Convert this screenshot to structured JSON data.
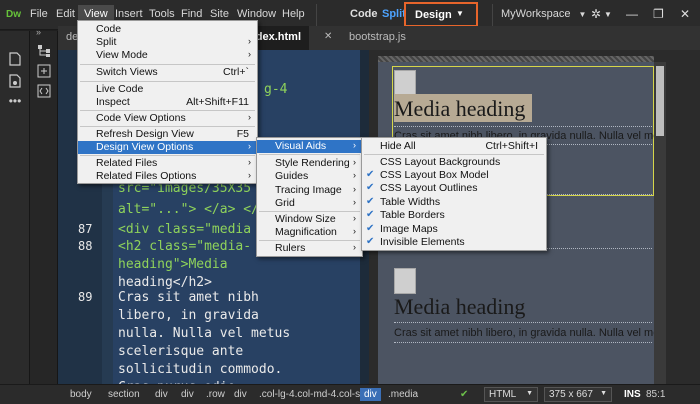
{
  "app": {
    "logo": "Dw"
  },
  "menubar": {
    "items": [
      "File",
      "Edit",
      "View",
      "Insert",
      "Tools",
      "Find",
      "Site",
      "Window",
      "Help"
    ],
    "active": "View"
  },
  "modes": {
    "code": "Code",
    "split": "Split",
    "design": "Design"
  },
  "workspace": "MyWorkspace",
  "tabs": [
    "det",
    "index.html",
    "bootstrap.js"
  ],
  "view_menu": [
    {
      "label": "Code"
    },
    {
      "label": "Split",
      "arrow": true
    },
    {
      "label": "View Mode",
      "arrow": true
    },
    {
      "label": "Switch Views",
      "shortcut": "Ctrl+`"
    },
    {
      "label": "Live Code"
    },
    {
      "label": "Inspect",
      "shortcut": "Alt+Shift+F11"
    },
    {
      "label": "Code View Options",
      "arrow": true
    },
    {
      "label": "Refresh Design View",
      "shortcut": "F5"
    },
    {
      "label": "Design View Options",
      "arrow": true,
      "highlight": true
    },
    {
      "label": "Related Files",
      "arrow": true
    },
    {
      "label": "Related Files Options",
      "arrow": true
    }
  ],
  "design_view_options_menu": [
    {
      "label": "Visual Aids",
      "arrow": true,
      "highlight": true
    },
    {
      "label": "Style Rendering",
      "arrow": true
    },
    {
      "label": "Guides",
      "arrow": true
    },
    {
      "label": "Tracing Image",
      "arrow": true
    },
    {
      "label": "Grid",
      "arrow": true
    },
    {
      "label": "Window Size",
      "arrow": true
    },
    {
      "label": "Magnification",
      "arrow": true
    },
    {
      "label": "Rulers",
      "arrow": true
    }
  ],
  "visual_aids_menu": [
    {
      "label": "Hide All",
      "shortcut": "Ctrl+Shift+I",
      "checked": false
    },
    {
      "label": "CSS Layout Backgrounds",
      "checked": false
    },
    {
      "label": "CSS Layout Box Model",
      "checked": true
    },
    {
      "label": "CSS Layout Outlines",
      "checked": true
    },
    {
      "label": "Table Widths",
      "checked": true
    },
    {
      "label": "Table Borders",
      "checked": true
    },
    {
      "label": "Image Maps",
      "checked": true
    },
    {
      "label": "Invisible Elements",
      "checked": true
    }
  ],
  "code": {
    "fragments": {
      "g4": "g-4",
      "src": "src=\"images/35X35",
      "alt": "alt=\"...\"> </a> </",
      "div": "<div class=\"media",
      "h2": "<h2 class=\"media-",
      "heading": "heading\">Media",
      "heading2": "heading</h2>",
      "p1": "Cras sit amet nibh",
      "p2": "libero, in gravida",
      "p3": "nulla. Nulla vel metus",
      "p4": "scelerisque ante",
      "p5": "sollicitudin commodo.",
      "p6": "Cras purus odio"
    },
    "line_numbers": {
      "a": "87",
      "b": "88",
      "c": "89"
    }
  },
  "design": {
    "heading": "Media heading",
    "para": "Cras sit amet nibh libero, in gravida nulla. Nulla vel me",
    "para2": "Cras sit amet nibh libero, in gravida nulla. Nulla vel me"
  },
  "statusbar": {
    "crumbs": [
      "body",
      "section",
      "div",
      "div",
      ".row",
      "div",
      ".col-lg-4.col-md-4.col-sm-6",
      "div",
      ".media"
    ],
    "active_crumb": "div",
    "doc_type": "HTML",
    "size": "375 x 667",
    "mode": "INS",
    "position": "85:1"
  }
}
